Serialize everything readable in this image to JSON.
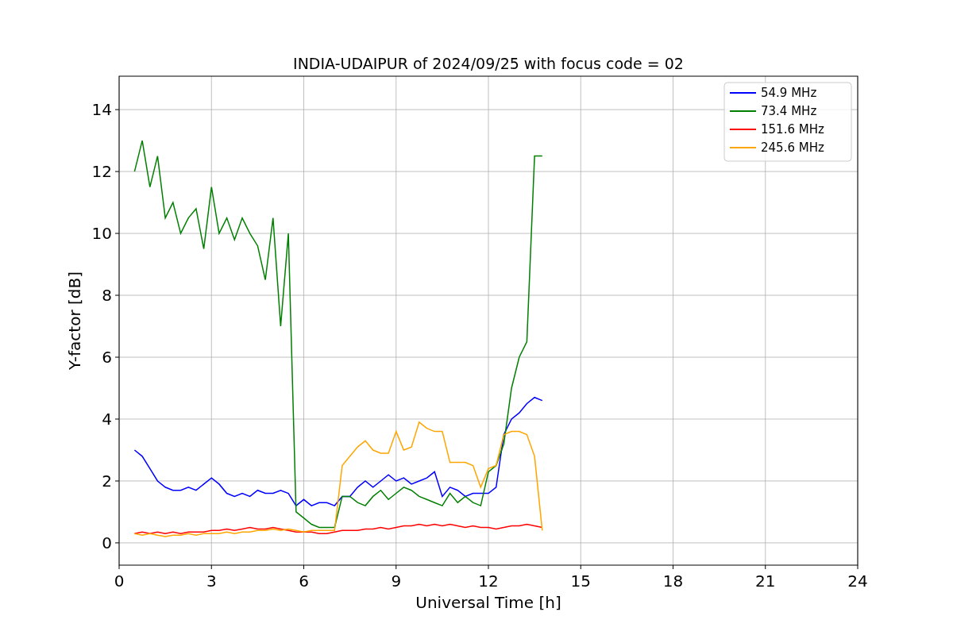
{
  "chart_data": {
    "type": "line",
    "title": "INDIA-UDAIPUR of 2024/09/25 with focus code = 02",
    "xlabel": "Universal Time [h]",
    "ylabel": "Y-factor [dB]",
    "x": [
      0.5,
      0.75,
      1.0,
      1.25,
      1.5,
      1.75,
      2.0,
      2.25,
      2.5,
      2.75,
      3.0,
      3.25,
      3.5,
      3.75,
      4.0,
      4.25,
      4.5,
      4.75,
      5.0,
      5.25,
      5.5,
      5.75,
      6.0,
      6.25,
      6.5,
      6.75,
      7.0,
      7.25,
      7.5,
      7.75,
      8.0,
      8.25,
      8.5,
      8.75,
      9.0,
      9.25,
      9.5,
      9.75,
      10.0,
      10.25,
      10.5,
      10.75,
      11.0,
      11.25,
      11.5,
      11.75,
      12.0,
      12.25,
      12.5,
      12.75,
      13.0,
      13.25,
      13.5,
      13.75
    ],
    "series": [
      {
        "name": "54.9 MHz",
        "color": "#0000ff",
        "values": [
          3.0,
          2.8,
          2.4,
          2.0,
          1.8,
          1.7,
          1.7,
          1.8,
          1.7,
          1.9,
          2.1,
          1.9,
          1.6,
          1.5,
          1.6,
          1.5,
          1.7,
          1.6,
          1.6,
          1.7,
          1.6,
          1.2,
          1.4,
          1.2,
          1.3,
          1.3,
          1.2,
          1.5,
          1.5,
          1.8,
          2.0,
          1.8,
          2.0,
          2.2,
          2.0,
          2.1,
          1.9,
          2.0,
          2.1,
          2.3,
          1.5,
          1.8,
          1.7,
          1.5,
          1.6,
          1.6,
          1.6,
          1.8,
          3.5,
          4.0,
          4.2,
          4.5,
          4.7,
          4.6
        ]
      },
      {
        "name": "73.4 MHz",
        "color": "#008000",
        "values": [
          12,
          13,
          11.5,
          12.5,
          10.5,
          11,
          10,
          10.5,
          10.8,
          9.5,
          11.5,
          10,
          10.5,
          9.8,
          10.5,
          10,
          9.6,
          8.5,
          10.5,
          7,
          10,
          1.0,
          0.8,
          0.6,
          0.5,
          0.5,
          0.5,
          1.5,
          1.5,
          1.3,
          1.2,
          1.5,
          1.7,
          1.4,
          1.6,
          1.8,
          1.7,
          1.5,
          1.4,
          1.3,
          1.2,
          1.6,
          1.3,
          1.5,
          1.3,
          1.2,
          2.3,
          2.5,
          3.2,
          5,
          6,
          6.5,
          12.5,
          12.5
        ]
      },
      {
        "name": "151.6 MHz",
        "color": "#ff0000",
        "values": [
          0.3,
          0.35,
          0.3,
          0.35,
          0.3,
          0.35,
          0.3,
          0.35,
          0.35,
          0.35,
          0.4,
          0.4,
          0.45,
          0.4,
          0.45,
          0.5,
          0.45,
          0.45,
          0.5,
          0.45,
          0.4,
          0.35,
          0.35,
          0.35,
          0.3,
          0.3,
          0.35,
          0.4,
          0.4,
          0.4,
          0.45,
          0.45,
          0.5,
          0.45,
          0.5,
          0.55,
          0.55,
          0.6,
          0.55,
          0.6,
          0.55,
          0.6,
          0.55,
          0.5,
          0.55,
          0.5,
          0.5,
          0.45,
          0.5,
          0.55,
          0.55,
          0.6,
          0.55,
          0.5
        ]
      },
      {
        "name": "245.6 MHz",
        "color": "#ffa500",
        "values": [
          0.3,
          0.25,
          0.3,
          0.25,
          0.2,
          0.25,
          0.25,
          0.3,
          0.25,
          0.3,
          0.3,
          0.3,
          0.35,
          0.3,
          0.35,
          0.35,
          0.4,
          0.4,
          0.45,
          0.4,
          0.45,
          0.4,
          0.35,
          0.4,
          0.4,
          0.4,
          0.4,
          2.5,
          2.8,
          3.1,
          3.3,
          3.0,
          2.9,
          2.9,
          3.6,
          3.0,
          3.1,
          3.9,
          3.7,
          3.6,
          3.6,
          2.6,
          2.6,
          2.6,
          2.5,
          1.8,
          2.4,
          2.5,
          3.5,
          3.6,
          3.6,
          3.5,
          2.8,
          0.4
        ]
      }
    ],
    "xlim": [
      0,
      24
    ],
    "ylim": [
      -0.72,
      15.08
    ],
    "xticks": [
      0,
      3,
      6,
      9,
      12,
      15,
      18,
      21,
      24
    ],
    "yticks": [
      0,
      2,
      4,
      6,
      8,
      10,
      12,
      14
    ],
    "grid": true,
    "legend": true
  }
}
